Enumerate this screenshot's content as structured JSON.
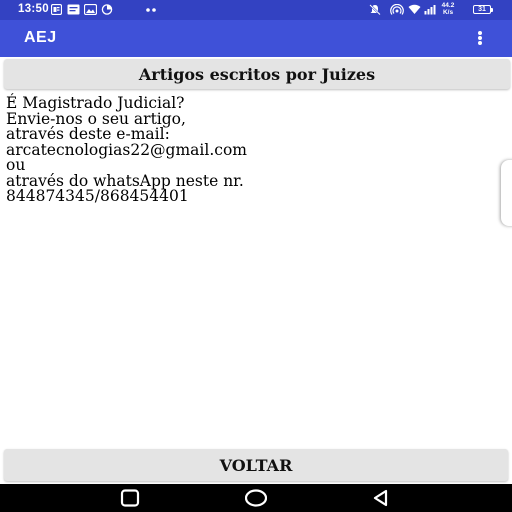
{
  "status_bar": {
    "time": "13:50",
    "network_speed_value": "44.2",
    "network_speed_unit": "K/s",
    "battery_level": "31",
    "background_color": "#3342c2"
  },
  "app_bar": {
    "title": "AEJ",
    "background_color": "#3f51d8",
    "menu_icon": "overflow-vertical-icon"
  },
  "header_button": {
    "label": "Artigos escritos por Juizes"
  },
  "message": {
    "lines": [
      "É Magistrado Judicial?",
      "Envie-nos o seu artigo,",
      "através deste e-mail:",
      "arcatecnologias22@gmail.com",
      "ou",
      "através do whatsApp neste nr.",
      "844874345/868454401"
    ]
  },
  "footer_button": {
    "label": "VOLTAR"
  },
  "nav_bar": {
    "keys": [
      "recents-icon",
      "home-icon",
      "back-icon"
    ]
  }
}
